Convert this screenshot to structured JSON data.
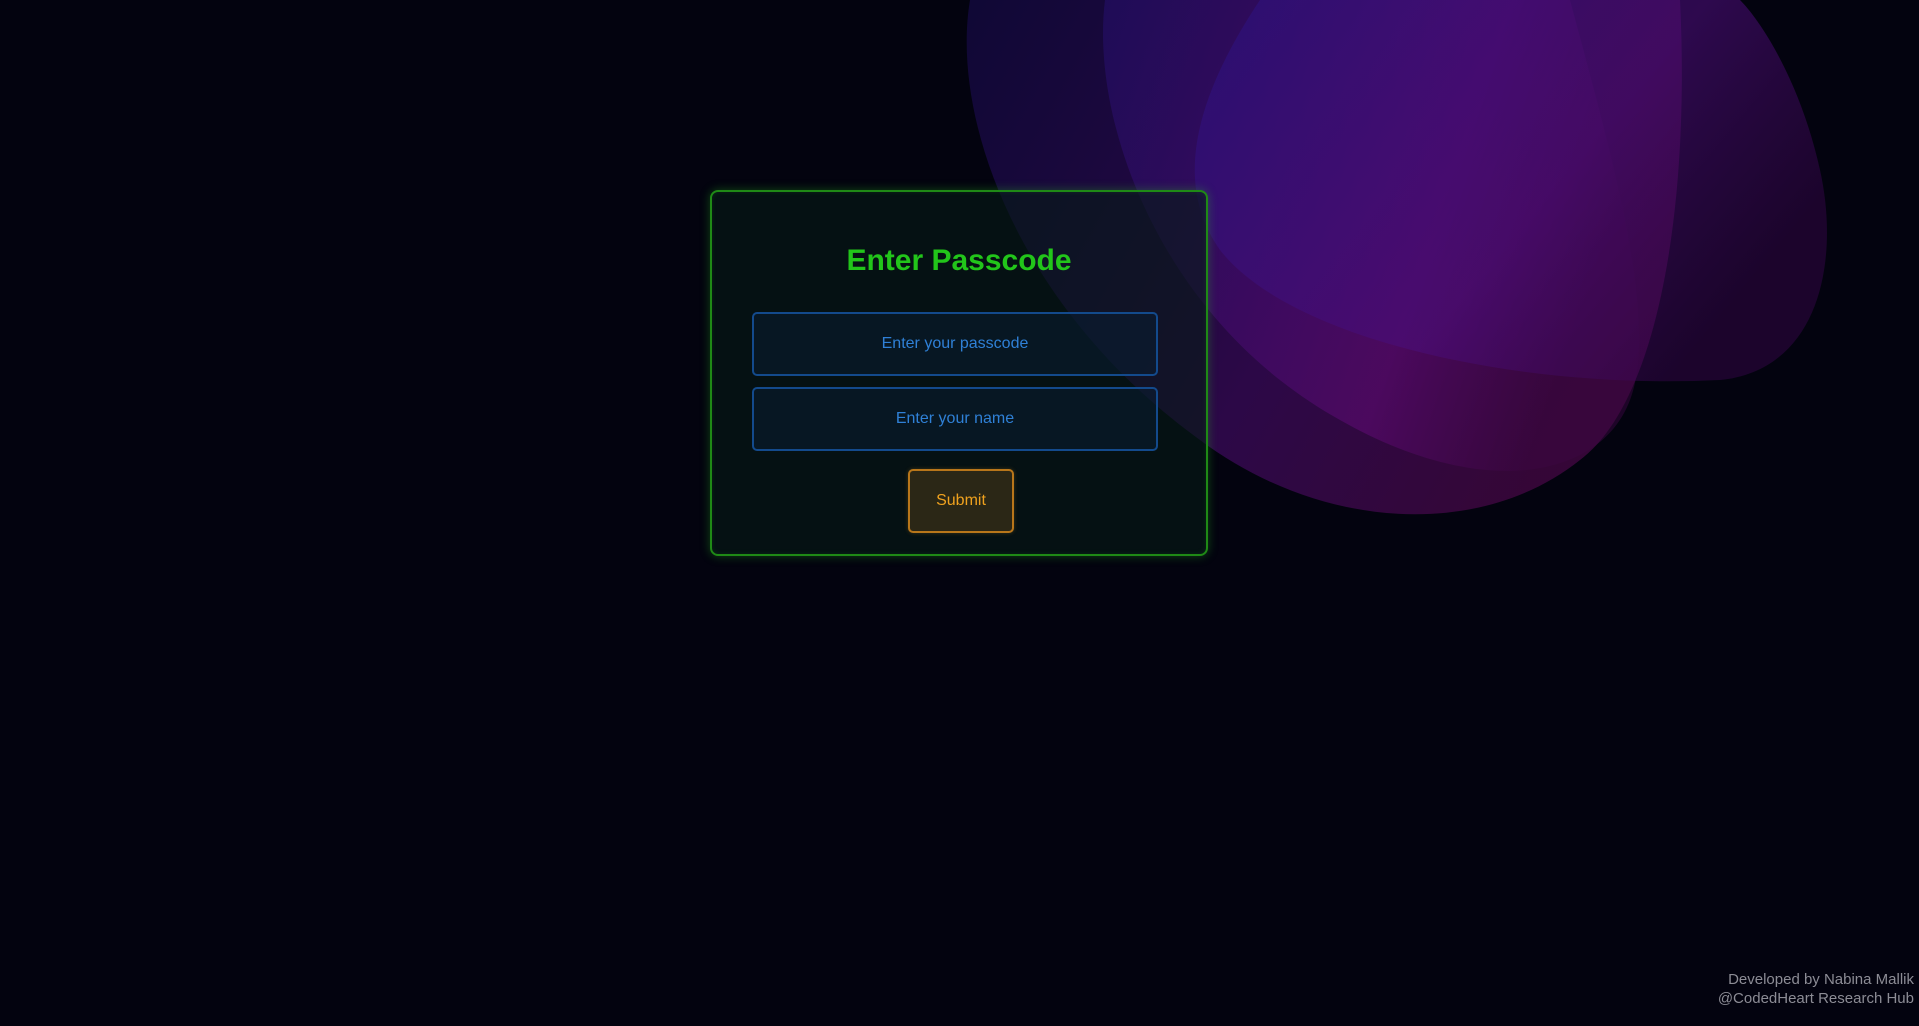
{
  "login": {
    "title": "Enter Passcode",
    "passcode_placeholder": "Enter your passcode",
    "name_placeholder": "Enter your name",
    "submit_label": "Submit"
  },
  "footer": {
    "credit": "Developed by Nabina Mallik",
    "org": "@CodedHeart Research Hub"
  },
  "colors": {
    "background": "#03030f",
    "title": "#22c51a",
    "card_border": "#1f8a16",
    "input_border": "#134a8c",
    "input_text": "#2f7fd4",
    "button_border": "#b8761a",
    "button_text": "#f0a21e",
    "footer_text": "#8c8c95",
    "blob_blue": "#2a1070",
    "blob_magenta": "#6a0a70"
  }
}
